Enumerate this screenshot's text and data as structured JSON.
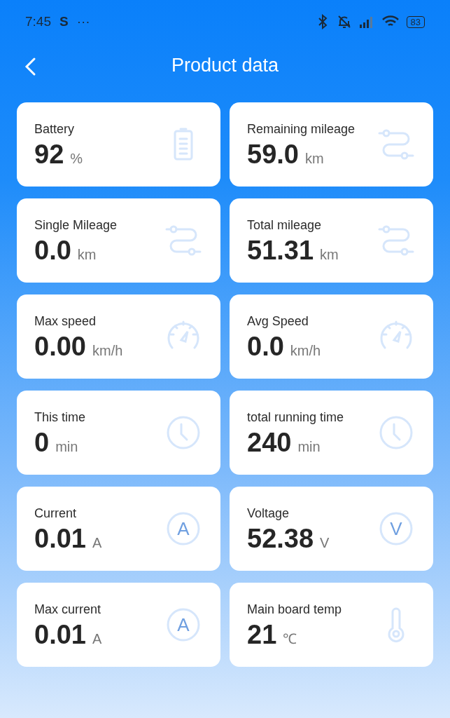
{
  "status_bar": {
    "time": "7:45",
    "app_letter": "S",
    "more": "···",
    "battery": "83"
  },
  "header": {
    "title": "Product data"
  },
  "cards": [
    {
      "label": "Battery",
      "value": "92",
      "unit": "%",
      "kind": "battery"
    },
    {
      "label": "Remaining mileage",
      "value": "59.0",
      "unit": "km",
      "kind": "route"
    },
    {
      "label": "Single Mileage",
      "value": "0.0",
      "unit": "km",
      "kind": "route"
    },
    {
      "label": "Total mileage",
      "value": "51.31",
      "unit": "km",
      "kind": "route"
    },
    {
      "label": "Max speed",
      "value": "0.00",
      "unit": "km/h",
      "kind": "gauge"
    },
    {
      "label": "Avg Speed",
      "value": "0.0",
      "unit": "km/h",
      "kind": "gauge"
    },
    {
      "label": "This time",
      "value": "0",
      "unit": "min",
      "kind": "clock"
    },
    {
      "label": "total running time",
      "value": "240",
      "unit": "min",
      "kind": "clock"
    },
    {
      "label": "Current",
      "value": "0.01",
      "unit": "A",
      "kind": "letter",
      "icon_text": "A"
    },
    {
      "label": "Voltage",
      "value": "52.38",
      "unit": "V",
      "kind": "letter",
      "icon_text": "V"
    },
    {
      "label": "Max current",
      "value": "0.01",
      "unit": "A",
      "kind": "letter",
      "icon_text": "A"
    },
    {
      "label": "Main board temp",
      "value": "21",
      "unit": "℃",
      "kind": "thermometer"
    }
  ]
}
